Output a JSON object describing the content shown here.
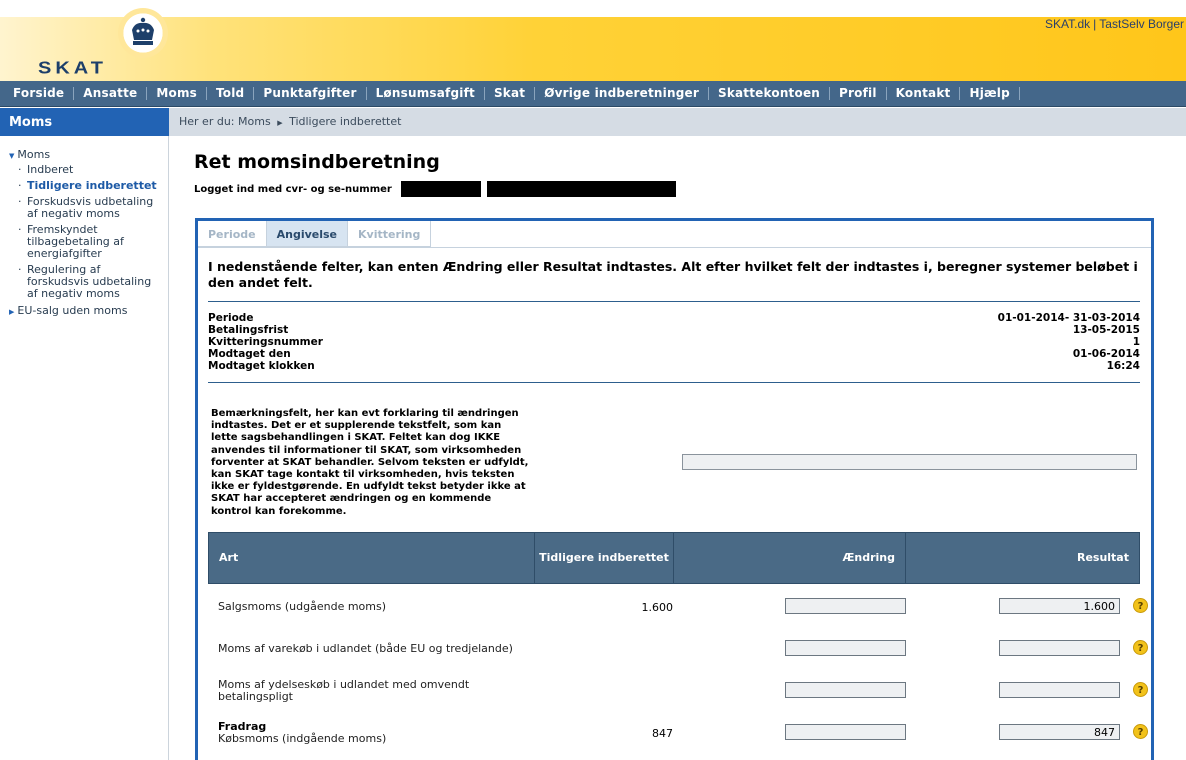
{
  "top_links": {
    "skat_dk": "SKAT.dk",
    "separator": "|",
    "tastselv": "TastSelv Borger"
  },
  "logo": {
    "text": "SKAT"
  },
  "colors": {
    "header_yellow": "#ffc61a",
    "nav_blue": "#44678a",
    "side_blue": "#2263b4",
    "table_head": "#4a6a86",
    "help_yellow": "#f2c21a"
  },
  "nav": [
    "Forside",
    "Ansatte",
    "Moms",
    "Told",
    "Punktafgifter",
    "Lønsumsafgift",
    "Skat",
    "Øvrige indberetninger",
    "Skattekontoen",
    "Profil",
    "Kontakt",
    "Hjælp"
  ],
  "sidebar": {
    "heading": "Moms",
    "moms": "Moms",
    "items": [
      "Indberet",
      "Tidligere indberettet",
      "Forskudsvis udbetaling af negativ moms",
      "Fremskyndet tilbagebetaling af energiafgifter",
      "Regulering af forskudsvis udbetaling af negativ moms"
    ],
    "eu": "EU-salg uden moms"
  },
  "breadcrumb": {
    "prefix": "Her er du:",
    "level1": "Moms",
    "level2": "Tidligere indberettet"
  },
  "page": {
    "title": "Ret momsindberetning",
    "logged_in": "Logget ind med cvr- og se-nummer"
  },
  "tabs": [
    "Periode",
    "Angivelse",
    "Kvittering"
  ],
  "intro": "I nedenstående felter, kan enten Ændring eller Resultat indtastes. Alt efter hvilket felt der indtastes i, beregner systemer beløbet i den andet felt.",
  "meta": [
    {
      "label": "Periode",
      "value": "01-01-2014- 31-03-2014"
    },
    {
      "label": "Betalingsfrist",
      "value": "13-05-2015"
    },
    {
      "label": "Kvitteringsnummer",
      "value": "1"
    },
    {
      "label": "Modtaget den",
      "value": "01-06-2014"
    },
    {
      "label": "Modtaget klokken",
      "value": "16:24"
    }
  ],
  "remark": "Bemærkningsfelt, her kan evt forklaring til ændringen indtastes. Det er et supplerende tekstfelt, som kan lette sagsbehandlingen i SKAT. Feltet kan dog IKKE anvendes til informationer til SKAT, som virksomheden forventer at SKAT behandler. Selvom teksten er udfyldt, kan SKAT tage kontakt til virksomheden, hvis teksten ikke er fyldestgørende. En udfyldt tekst betyder ikke at SKAT har accepteret ændringen og en kommende kontrol kan forekomme.",
  "table": {
    "headers": {
      "art": "Art",
      "prev": "Tidligere indberettet",
      "change": "Ændring",
      "result": "Resultat"
    },
    "rows": [
      {
        "label": "Salgsmoms (udgående moms)",
        "prev": "1.600",
        "change": "",
        "result": "1.600"
      },
      {
        "label": "Moms af varekøb i udlandet (både EU og tredjelande)",
        "prev": "",
        "change": "",
        "result": ""
      },
      {
        "label": "Moms af ydelseskøb i udlandet med omvendt betalingspligt",
        "prev": "",
        "change": "",
        "result": ""
      },
      {
        "heading": "Fradrag",
        "label": "Købsmoms (indgående moms)",
        "prev": "847",
        "change": "",
        "result": "847"
      }
    ],
    "help_glyph": "?"
  }
}
